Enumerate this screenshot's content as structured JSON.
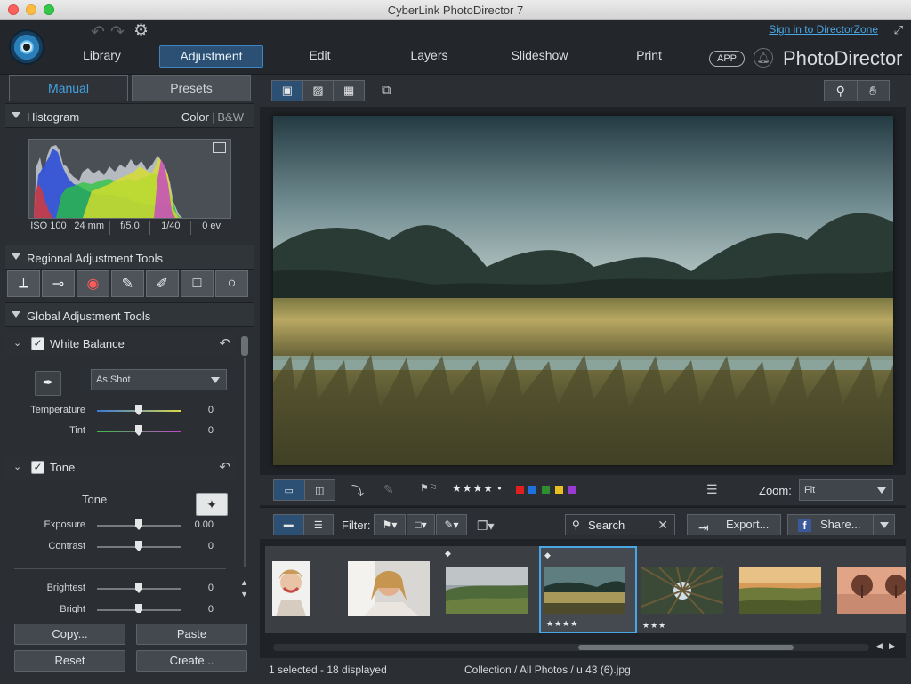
{
  "window": {
    "title": "CyberLink PhotoDirector 7"
  },
  "top": {
    "nav": [
      "Library",
      "Adjustment",
      "Edit",
      "Layers",
      "Slideshow",
      "Print"
    ],
    "signin": "Sign in to DirectorZone",
    "app_badge": "APP",
    "brand": "PhotoDirector"
  },
  "left": {
    "tabs": [
      "Manual",
      "Presets"
    ],
    "histogram": {
      "title": "Histogram",
      "mode_color": "Color",
      "mode_bw": "B&W",
      "exif": [
        "ISO 100",
        "24 mm",
        "f/5.0",
        "1/40",
        "0 ev"
      ]
    },
    "regional_title": "Regional Adjustment Tools",
    "global_title": "Global Adjustment Tools",
    "white_balance": {
      "title": "White Balance",
      "preset": "As Shot",
      "temperature_label": "Temperature",
      "temperature_value": "0",
      "tint_label": "Tint",
      "tint_value": "0"
    },
    "tone": {
      "title": "Tone",
      "tone_label": "Tone",
      "exposure_label": "Exposure",
      "exposure_value": "0.00",
      "contrast_label": "Contrast",
      "contrast_value": "0",
      "brightest_label": "Brightest",
      "brightest_value": "0",
      "bright_label": "Bright",
      "bright_value": "0"
    },
    "buttons": {
      "copy": "Copy...",
      "paste": "Paste",
      "reset": "Reset",
      "create": "Create..."
    }
  },
  "main": {
    "zoom_label": "Zoom:",
    "zoom_value": "Fit",
    "rating_filter": "★★★★ •",
    "color_labels": [
      "#e02020",
      "#1f6fe0",
      "#2f8f2f",
      "#e8c020",
      "#9a3ad0"
    ],
    "filter_label": "Filter:",
    "search": "Search",
    "export": "Export...",
    "share": "Share...",
    "thumbnails": [
      {
        "rating": "",
        "edited": false
      },
      {
        "rating": "",
        "edited": false
      },
      {
        "rating": "",
        "edited": true
      },
      {
        "rating": "★★★★",
        "edited": true,
        "selected": true
      },
      {
        "rating": "★★★",
        "edited": false
      },
      {
        "rating": "",
        "edited": false
      },
      {
        "rating": "",
        "edited": false
      }
    ],
    "status_left": "1 selected - 18 displayed",
    "status_path": "Collection / All Photos / u 43 (6).jpg"
  }
}
